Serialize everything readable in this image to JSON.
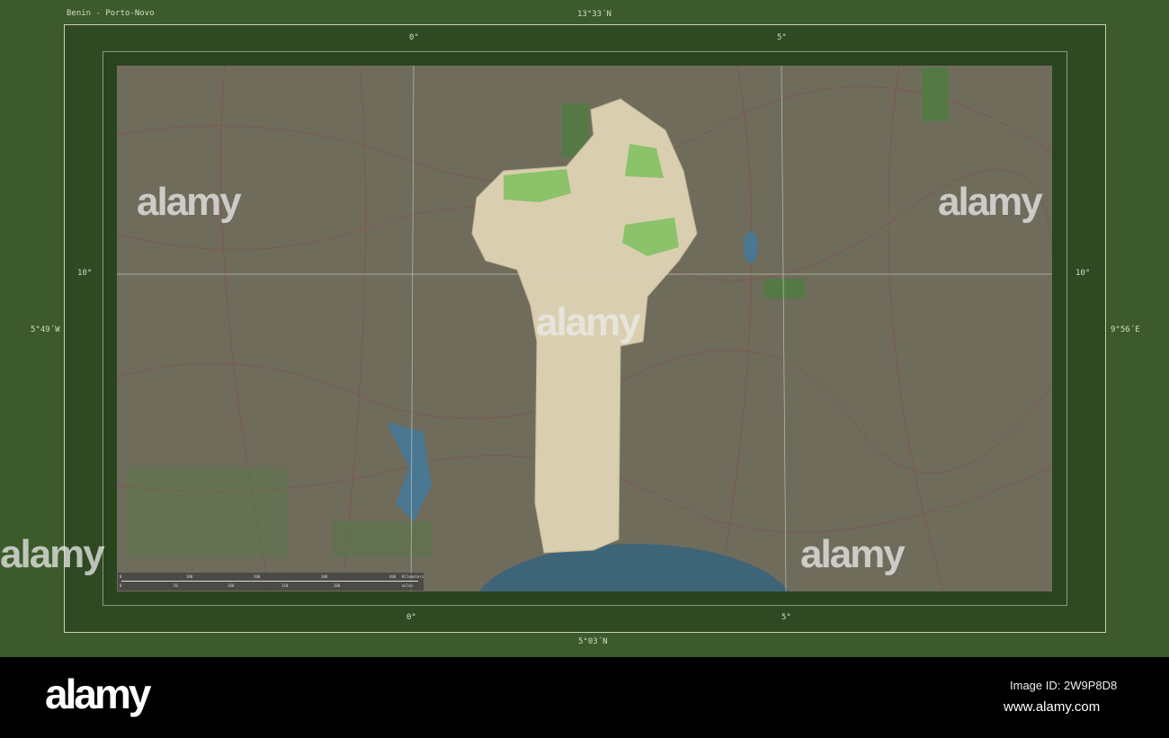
{
  "title": "Benin - Porto-Novo",
  "lat_top": "13°33´N",
  "lat_bottom": "5°03´N",
  "lon_left": "5°49´W",
  "lon_right": "9°56´E",
  "grid_labels": {
    "lon_0": "0°",
    "lon_5": "5°",
    "lat_10": "10°"
  },
  "scale": {
    "top_ticks": [
      "0",
      "100",
      "200",
      "300",
      "400",
      "Kilometers"
    ],
    "bottom_ticks": [
      "0",
      "50",
      "100",
      "150",
      "200",
      "miles"
    ]
  },
  "watermark": "alamy",
  "footer": {
    "logo": "alamy",
    "image_id": "Image ID: 2W9P8D8",
    "url": "www.alamy.com"
  },
  "colors": {
    "background": "#3c5a2b",
    "map": "#6f6c5c",
    "highlight": "#d9cfb0",
    "ocean": "#3e6478"
  }
}
